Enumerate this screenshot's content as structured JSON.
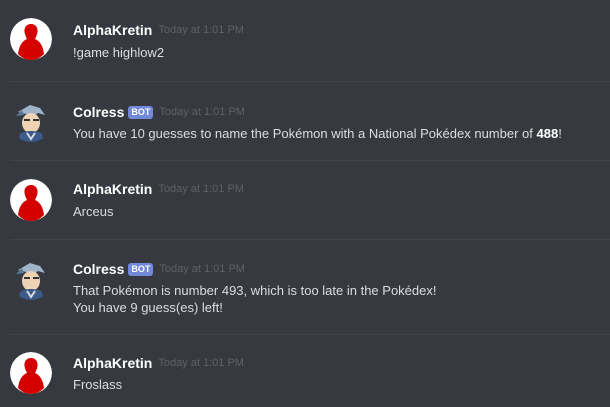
{
  "messages": [
    {
      "author": "AlphaKretin",
      "avatar_icon": "red-silhouette-avatar",
      "timestamp": "Today at 1:01 PM",
      "lines": [
        "!game highlow2"
      ]
    },
    {
      "author": "Colress",
      "bot_tag": "BOT",
      "avatar_icon": "colress-avatar",
      "timestamp": "Today at 1:01 PM",
      "line_prefix": "You have 10 guesses to name the Pokémon with a National Pokédex number of ",
      "line_number": "488",
      "line_suffix": "!"
    },
    {
      "author": "AlphaKretin",
      "avatar_icon": "red-silhouette-avatar",
      "timestamp": "Today at 1:01 PM",
      "lines": [
        "Arceus"
      ]
    },
    {
      "author": "Colress",
      "bot_tag": "BOT",
      "avatar_icon": "colress-avatar",
      "timestamp": "Today at 1:01 PM",
      "lines": [
        "That Pokémon is number 493, which is too late in the Pokédex!",
        "You have 9 guess(es) left!"
      ]
    },
    {
      "author": "AlphaKretin",
      "avatar_icon": "red-silhouette-avatar",
      "timestamp": "Today at 1:01 PM",
      "lines": [
        "Froslass"
      ]
    }
  ],
  "colors": {
    "background": "#36393f",
    "username": "#ffffff",
    "timestamp": "#5f6167",
    "text": "#dcddde",
    "bot_tag": "#7289da",
    "avatar_red": "#d40000"
  }
}
